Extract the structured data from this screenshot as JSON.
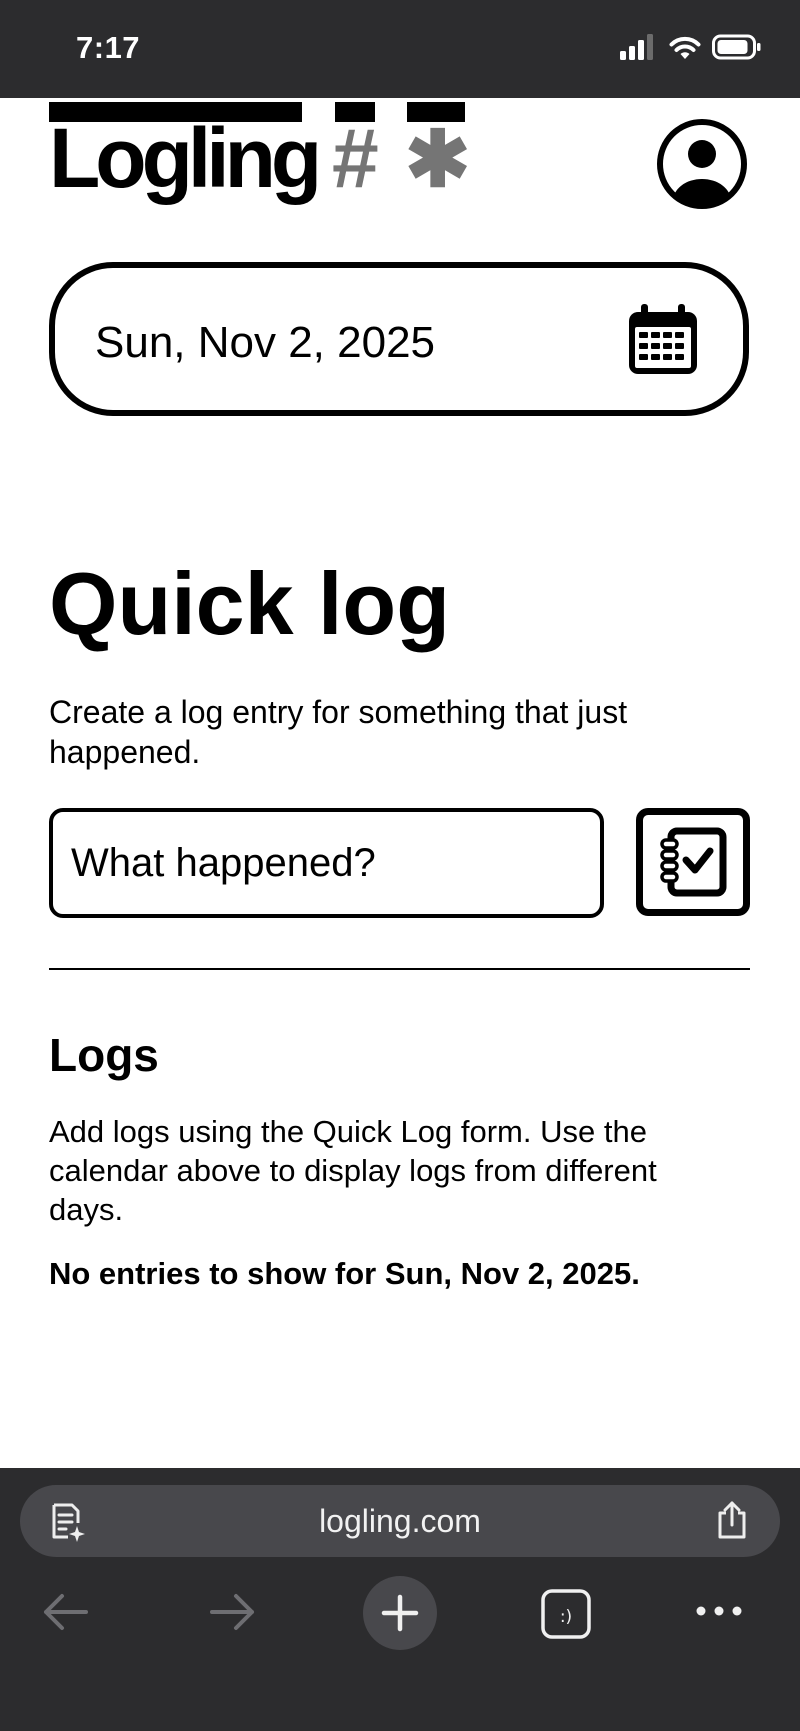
{
  "status_bar": {
    "time": "7:17"
  },
  "header": {
    "logo_text": "Logling",
    "logo_glyph_1": "#",
    "logo_glyph_2": "✱",
    "profile_icon": "user-circle-icon"
  },
  "date_picker": {
    "value": "Sun, Nov 2, 2025",
    "icon": "calendar-icon"
  },
  "quick_log": {
    "title": "Quick log",
    "description": "Create a log entry for something that just happened.",
    "input_placeholder": "What happened?",
    "submit_icon": "notebook-check-icon"
  },
  "logs": {
    "title": "Logs",
    "description": "Add logs using the Quick Log form. Use the calendar above to display logs from different days.",
    "empty_message": "No entries to show for Sun, Nov 2, 2025."
  },
  "browser": {
    "url": "logling.com",
    "reader_icon": "reader-icon",
    "share_icon": "share-icon",
    "nav": [
      "back-arrow-icon",
      "forward-arrow-icon",
      "plus-icon",
      "tabs-icon",
      "more-icon"
    ]
  },
  "colors": {
    "status_bar_bg": "#2c2c2e",
    "logo_accent": "#757575",
    "browser_pill": "#48484c"
  }
}
